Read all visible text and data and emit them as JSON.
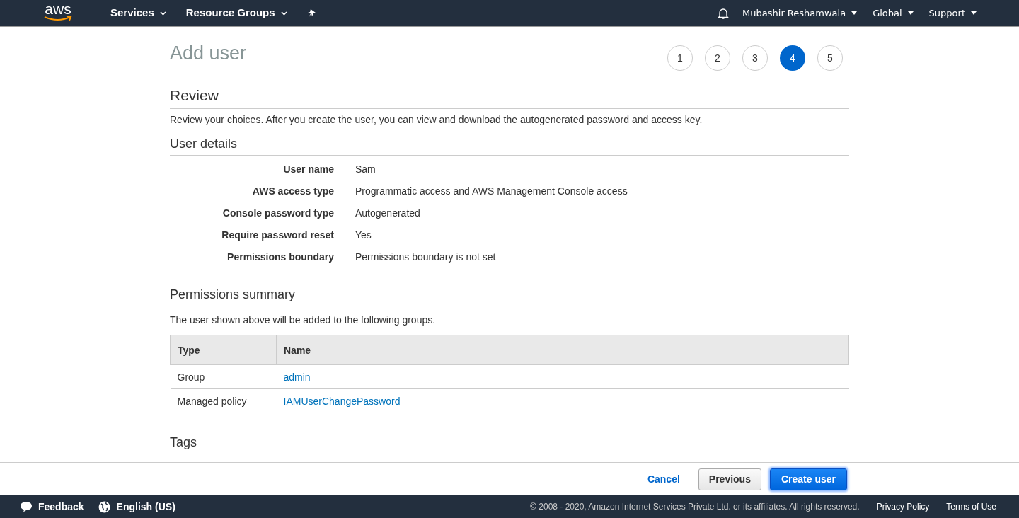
{
  "top_nav": {
    "logo": "aws",
    "menus": [
      {
        "label": "Services"
      },
      {
        "label": "Resource Groups"
      }
    ],
    "right_menus": [
      {
        "label": "Mubashir Reshamwala"
      },
      {
        "label": "Global"
      },
      {
        "label": "Support"
      }
    ]
  },
  "page_title": "Add user",
  "steps": [
    {
      "label": "1",
      "selected": false
    },
    {
      "label": "2",
      "selected": false
    },
    {
      "label": "3",
      "selected": false
    },
    {
      "label": "4",
      "selected": true
    },
    {
      "label": "5",
      "selected": false
    }
  ],
  "review": {
    "title": "Review",
    "description": "Review your choices. After you create the user, you can view and download the autogenerated password and access key."
  },
  "user_details": {
    "title": "User details",
    "rows": [
      {
        "label": "User name",
        "value": "Sam"
      },
      {
        "label": "AWS access type",
        "value": "Programmatic access and AWS Management Console access"
      },
      {
        "label": "Console password type",
        "value": "Autogenerated"
      },
      {
        "label": "Require password reset",
        "value": "Yes"
      },
      {
        "label": "Permissions boundary",
        "value": "Permissions boundary is not set"
      }
    ]
  },
  "permissions_summary": {
    "title": "Permissions summary",
    "description": "The user shown above will be added to the following groups.",
    "table": {
      "columns": [
        "Type",
        "Name"
      ],
      "rows": [
        {
          "type": "Group",
          "name": "admin"
        },
        {
          "type": "Managed policy",
          "name": "IAMUserChangePassword"
        }
      ]
    }
  },
  "tags": {
    "title": "Tags"
  },
  "actions": {
    "cancel": "Cancel",
    "previous": "Previous",
    "create": "Create user"
  },
  "footer": {
    "feedback": "Feedback",
    "language": "English (US)",
    "copyright": "© 2008 - 2020, Amazon Internet Services Private Ltd. or its affiliates. All rights reserved.",
    "links": [
      "Privacy Policy",
      "Terms of Use"
    ]
  }
}
